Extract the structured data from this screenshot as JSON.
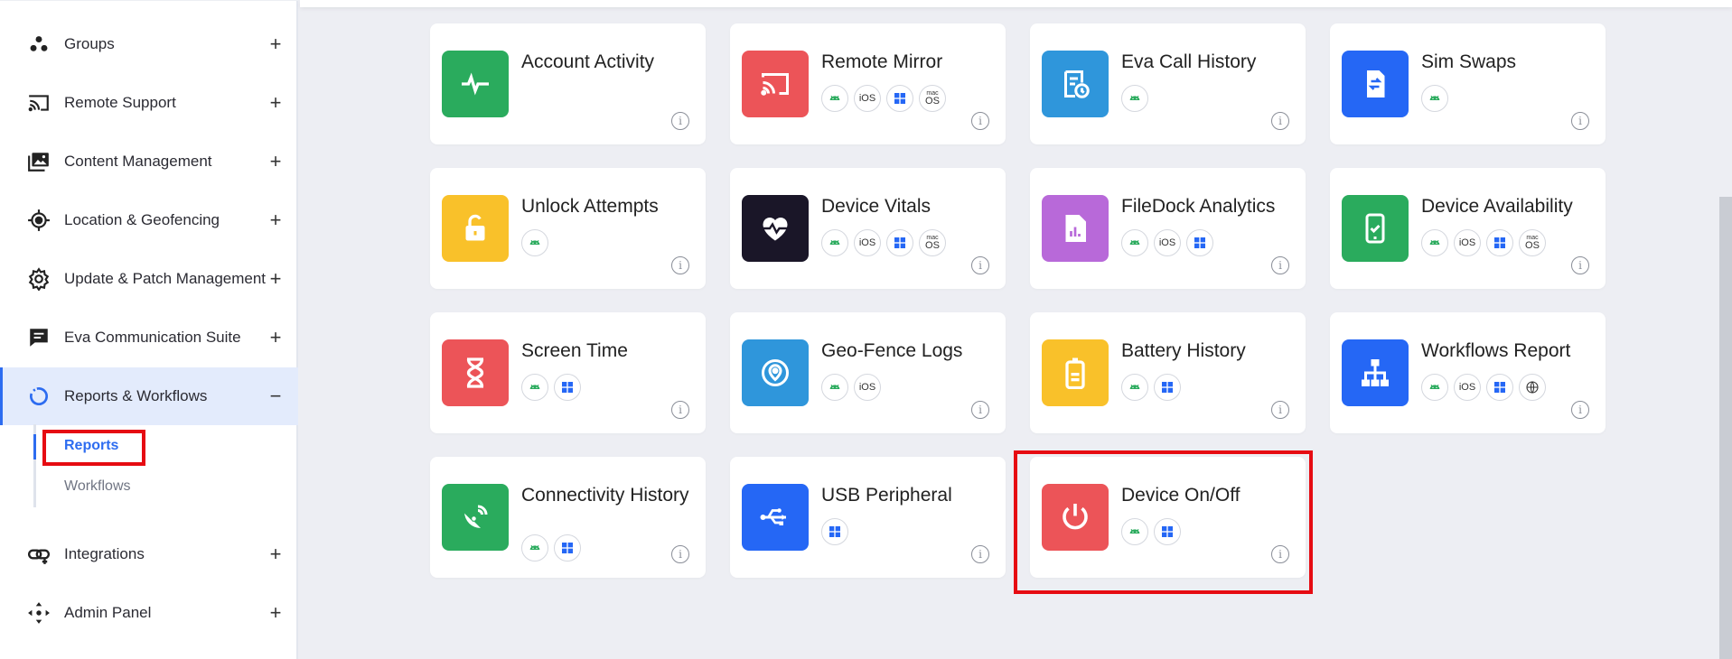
{
  "sidebar": {
    "items": [
      {
        "label": "Groups",
        "icon": "groups-icon",
        "toggle": "+"
      },
      {
        "label": "Remote Support",
        "icon": "cast-icon",
        "toggle": "+"
      },
      {
        "label": "Content Management",
        "icon": "images-icon",
        "toggle": "+"
      },
      {
        "label": "Location & Geofencing",
        "icon": "location-target-icon",
        "toggle": "+"
      },
      {
        "label": "Update & Patch Management",
        "icon": "gear-icon",
        "toggle": "+"
      },
      {
        "label": "Eva Communication Suite",
        "icon": "chat-icon",
        "toggle": "+"
      },
      {
        "label": "Reports & Workflows",
        "icon": "reports-loop-icon",
        "toggle": "−"
      },
      {
        "label": "Integrations",
        "icon": "integrations-icon",
        "toggle": "+"
      },
      {
        "label": "Admin Panel",
        "icon": "admin-move-icon",
        "toggle": "+"
      }
    ],
    "subitems": [
      {
        "label": "Reports",
        "active": true
      },
      {
        "label": "Workflows",
        "active": false
      }
    ]
  },
  "cards": [
    {
      "title": "Account Activity",
      "color": "#2aab5d",
      "icon": "activity-pulse-icon",
      "platforms": []
    },
    {
      "title": "Remote Mirror",
      "color": "#ec5458",
      "icon": "cast-icon",
      "platforms": [
        "android",
        "ios",
        "windows",
        "macos"
      ]
    },
    {
      "title": "Eva Call History",
      "color": "#2f96db",
      "icon": "call-history-icon",
      "platforms": [
        "android"
      ]
    },
    {
      "title": "Sim Swaps",
      "color": "#2567f5",
      "icon": "sim-swap-icon",
      "platforms": [
        "android"
      ]
    },
    {
      "title": "Unlock Attempts",
      "color": "#f9c12a",
      "icon": "unlock-icon",
      "platforms": [
        "android"
      ]
    },
    {
      "title": "Device Vitals",
      "color": "#1a1628",
      "icon": "heart-pulse-icon",
      "platforms": [
        "android",
        "ios",
        "windows",
        "macos"
      ]
    },
    {
      "title": "FileDock Analytics",
      "color": "#b869d9",
      "icon": "file-chart-icon",
      "platforms": [
        "android",
        "ios",
        "windows"
      ]
    },
    {
      "title": "Device Availability",
      "color": "#2aab5d",
      "icon": "phone-check-icon",
      "platforms": [
        "android",
        "ios",
        "windows",
        "macos"
      ]
    },
    {
      "title": "Screen Time",
      "color": "#ec5458",
      "icon": "hourglass-icon",
      "platforms": [
        "android",
        "windows"
      ]
    },
    {
      "title": "Geo-Fence Logs",
      "color": "#2f96db",
      "icon": "geofence-pin-icon",
      "platforms": [
        "android",
        "ios"
      ]
    },
    {
      "title": "Battery History",
      "color": "#f9c12a",
      "icon": "battery-icon",
      "platforms": [
        "android",
        "windows"
      ]
    },
    {
      "title": "Workflows Report",
      "color": "#2567f5",
      "icon": "hierarchy-icon",
      "platforms": [
        "android",
        "ios",
        "windows",
        "web"
      ]
    },
    {
      "title": "Connectivity History",
      "color": "#2aab5d",
      "icon": "satellite-dish-icon",
      "platforms": [
        "android",
        "windows"
      ]
    },
    {
      "title": "USB Peripheral",
      "color": "#2567f5",
      "icon": "usb-icon",
      "platforms": [
        "windows"
      ]
    },
    {
      "title": "Device On/Off",
      "color": "#ec5458",
      "icon": "power-icon",
      "platforms": [
        "android",
        "windows"
      ]
    }
  ],
  "badge_text": {
    "ios": "iOS",
    "mac_small": "mac",
    "mac_big": "OS"
  },
  "info_glyph": "i",
  "highlights": [
    "Reports",
    "Device On/Off"
  ]
}
